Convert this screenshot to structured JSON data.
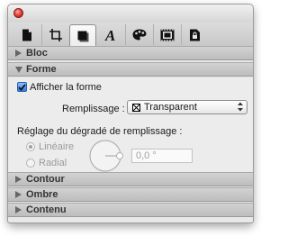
{
  "tabs": [
    {
      "icon": "document-icon"
    },
    {
      "icon": "crop-frame-icon"
    },
    {
      "icon": "shape-square-icon",
      "active": true
    },
    {
      "icon": "text-a-icon"
    },
    {
      "icon": "color-palette-icon"
    },
    {
      "icon": "film-frame-icon"
    },
    {
      "icon": "lock-document-icon"
    }
  ],
  "sections": {
    "bloc": "Bloc",
    "forme": "Forme",
    "contour": "Contour",
    "ombre": "Ombre",
    "contenu": "Contenu"
  },
  "forme": {
    "show_shape_label": "Afficher la forme",
    "show_shape_checked": true,
    "fill_label": "Remplissage :",
    "fill_value": "Transparent",
    "gradient_label": "Réglage du dégradé de remplissage :",
    "linear_label": "Linéaire",
    "linear_selected": true,
    "radial_label": "Radial",
    "angle_value": "0,0 °"
  },
  "colors": {
    "accent": "#2f78e0",
    "close": "#e5453a"
  }
}
